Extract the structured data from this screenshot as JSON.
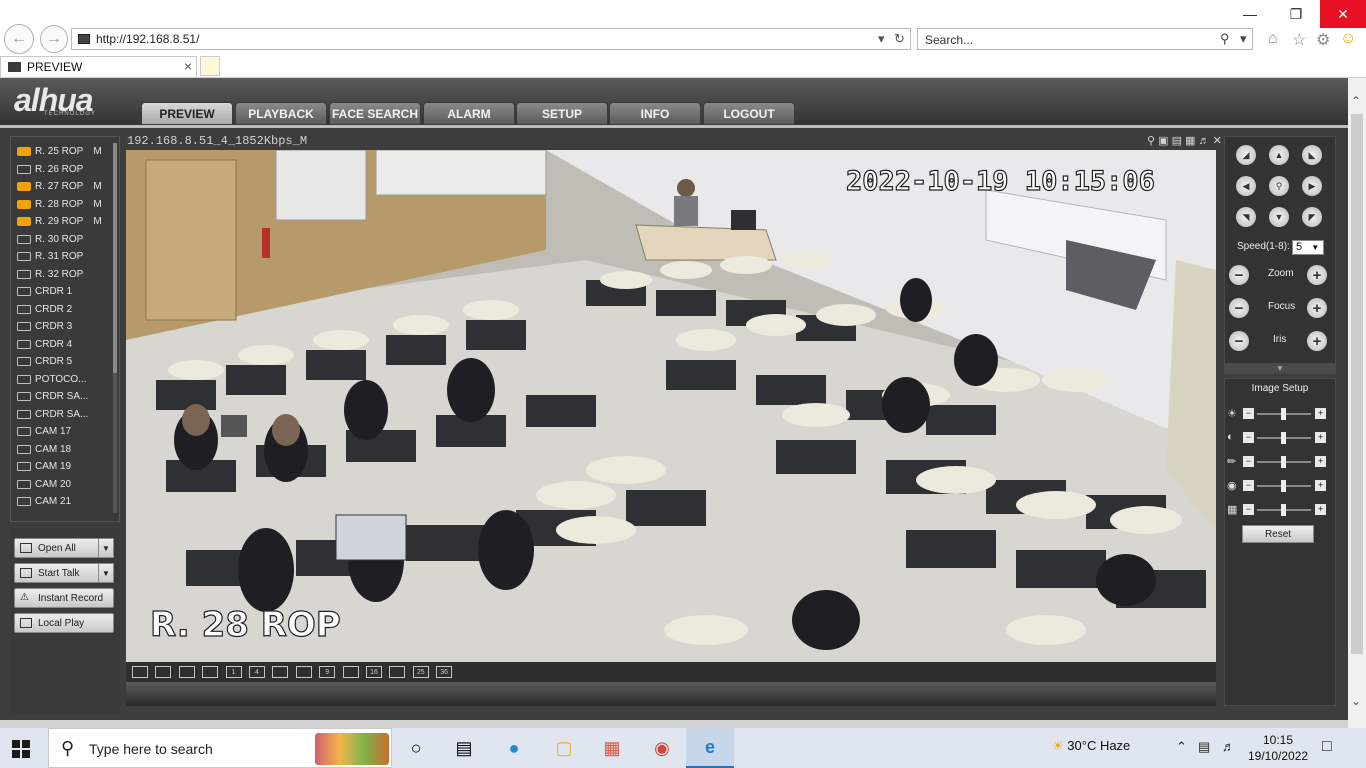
{
  "browser": {
    "address": "http://192.168.8.51/",
    "search_placeholder": "Search...",
    "tab_title": "PREVIEW"
  },
  "app": {
    "logo": "alhua",
    "logo_sub": "TECHNOLOGY",
    "menu": [
      "PREVIEW",
      "PLAYBACK",
      "FACE SEARCH",
      "ALARM",
      "SETUP",
      "INFO",
      "LOGOUT"
    ],
    "active_menu": "PREVIEW"
  },
  "channels": [
    {
      "name": "R. 25 ROP",
      "status": "M",
      "active": true
    },
    {
      "name": "R. 26 ROP",
      "status": "",
      "active": false
    },
    {
      "name": "R. 27 ROP",
      "status": "M",
      "active": true
    },
    {
      "name": "R. 28 ROP",
      "status": "M",
      "active": true
    },
    {
      "name": "R. 29 ROP",
      "status": "M",
      "active": true
    },
    {
      "name": "R. 30 ROP",
      "status": "",
      "active": false
    },
    {
      "name": "R. 31 ROP",
      "status": "",
      "active": false
    },
    {
      "name": "R. 32 ROP",
      "status": "",
      "active": false
    },
    {
      "name": "CRDR 1",
      "status": "",
      "active": false
    },
    {
      "name": "CRDR 2",
      "status": "",
      "active": false
    },
    {
      "name": "CRDR 3",
      "status": "",
      "active": false
    },
    {
      "name": "CRDR 4",
      "status": "",
      "active": false
    },
    {
      "name": "CRDR 5",
      "status": "",
      "active": false
    },
    {
      "name": "POTOCO...",
      "status": "",
      "active": false
    },
    {
      "name": "CRDR SA...",
      "status": "",
      "active": false
    },
    {
      "name": "CRDR SA...",
      "status": "",
      "active": false
    },
    {
      "name": "CAM 17",
      "status": "",
      "active": false
    },
    {
      "name": "CAM 18",
      "status": "",
      "active": false
    },
    {
      "name": "CAM 19",
      "status": "",
      "active": false
    },
    {
      "name": "CAM 20",
      "status": "",
      "active": false
    },
    {
      "name": "CAM 21",
      "status": "",
      "active": false
    }
  ],
  "actions": {
    "open_all": "Open All",
    "start_talk": "Start Talk",
    "instant_record": "Instant Record",
    "local_play": "Local Play"
  },
  "video": {
    "stream_label": "192.168.8.51_4_1852Kbps_M",
    "timestamp": "2022-10-19 10:15:06",
    "camera_name": "R. 28 ROP",
    "layout_buttons": [
      "",
      "",
      "",
      "",
      "1",
      "4",
      "",
      "",
      "9",
      "",
      "16",
      "",
      "25",
      "36"
    ]
  },
  "ptz": {
    "speed_label": "Speed(1-8):",
    "speed_value": "5",
    "zoom": "Zoom",
    "focus": "Focus",
    "iris": "Iris"
  },
  "image_setup": {
    "title": "Image Setup",
    "reset": "Reset",
    "rows": [
      "brightness-icon",
      "contrast-icon",
      "saturation-icon",
      "hue-icon",
      "sharpness-icon"
    ]
  },
  "taskbar": {
    "search_placeholder": "Type here to search",
    "weather": "30°C  Haze",
    "time": "10:15",
    "date": "19/10/2022"
  }
}
